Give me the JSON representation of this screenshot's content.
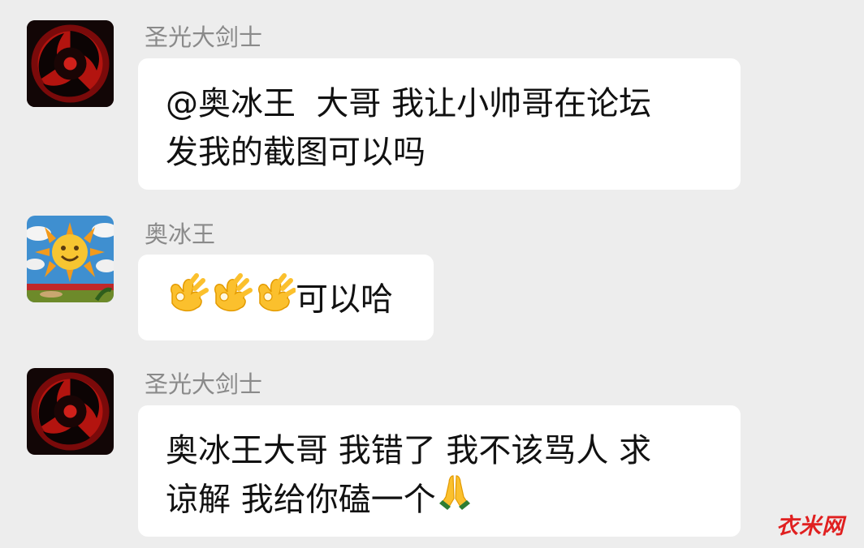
{
  "messages": [
    {
      "sender": "圣光大剑士",
      "avatar_icon": "sharingan-icon",
      "lines": [
        "@奥冰王  大哥 我让小帅哥在论坛",
        "发我的截图可以吗"
      ]
    },
    {
      "sender": "奥冰王",
      "avatar_icon": "sun-mosaic-icon",
      "emoji_icon": "ok-hand-emoji",
      "text": "可以哈"
    },
    {
      "sender": "圣光大剑士",
      "avatar_icon": "sharingan-icon",
      "lines": [
        "奥冰王大哥 我错了 我不该骂人 求",
        "谅解 我给你磕一个"
      ],
      "emoji_icon": "folded-hands-emoji"
    }
  ],
  "watermark": "衣米网",
  "colors": {
    "background": "#ededed",
    "bubble": "#ffffff",
    "sender": "#8a8a8a",
    "text": "#111111",
    "watermark": "#e02020"
  }
}
